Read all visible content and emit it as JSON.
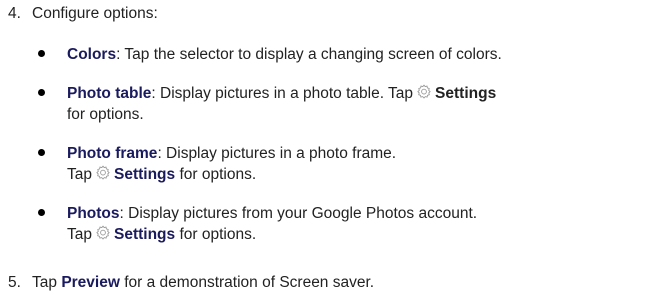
{
  "step4": {
    "number": "4.",
    "text": "Configure options:"
  },
  "items": [
    {
      "term": "Colors",
      "line1": ": Tap the selector to display a changing screen of colors."
    },
    {
      "term": "Photo table",
      "line1": ": Display pictures in a photo table. Tap",
      "icon": "settings-gear-icon",
      "settings_label": "Settings",
      "line2": "for options."
    },
    {
      "term": "Photo frame",
      "line1": ": Display pictures in a photo frame.",
      "line2_prefix": "Tap",
      "icon": "settings-gear-icon",
      "settings_label": "Settings",
      "line2_suffix": "for options."
    },
    {
      "term": "Photos",
      "line1": ": Display pictures from your Google Photos account.",
      "line2_prefix": "Tap",
      "icon": "settings-gear-icon",
      "settings_label": "Settings",
      "line2_suffix": "for options."
    }
  ],
  "step5": {
    "number": "5.",
    "prefix": "Tap",
    "link": "Preview",
    "suffix": "for a demonstration of Screen saver."
  }
}
